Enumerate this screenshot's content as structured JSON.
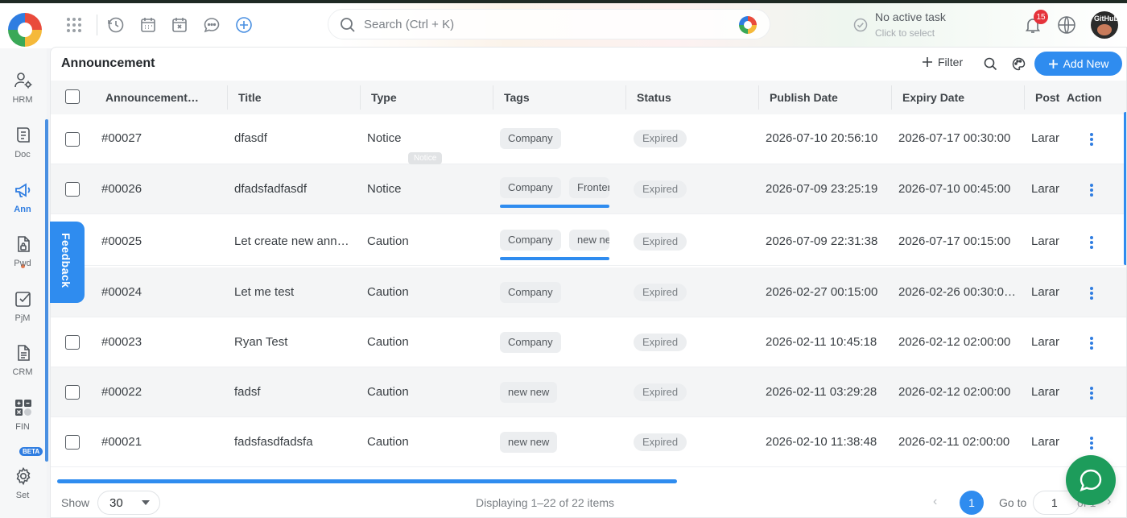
{
  "header": {
    "search_placeholder": "Search (Ctrl + K)",
    "task_title": "No active task",
    "task_subtitle": "Click to select",
    "notification_count": "15",
    "avatar_label": "GitHub"
  },
  "sidebar": {
    "items": [
      {
        "label": "HRM",
        "icon": "users-gear-icon"
      },
      {
        "label": "Doc",
        "icon": "document-icon"
      },
      {
        "label": "Ann",
        "icon": "megaphone-icon",
        "active": true
      },
      {
        "label": "Pwd",
        "icon": "password-file-icon"
      },
      {
        "label": "PjM",
        "icon": "checkbox-icon"
      },
      {
        "label": "CRM",
        "icon": "file-list-icon"
      },
      {
        "label": "FIN",
        "icon": "calculator-icon"
      },
      {
        "label": "Set",
        "icon": "settings-gear-icon"
      }
    ],
    "beta_label": "BETA"
  },
  "page": {
    "title": "Announcement",
    "filter_label": "Filter",
    "add_label": "Add New",
    "tooltip": "Notice",
    "feedback_label": "Feedback"
  },
  "table": {
    "columns": [
      "Announcement…",
      "Title",
      "Type",
      "Tags",
      "Status",
      "Publish Date",
      "Expiry Date",
      "Post",
      "Action"
    ],
    "rows": [
      {
        "id": "#00027",
        "title": "dfasdf",
        "type": "Notice",
        "tags": [
          "Company"
        ],
        "status": "Expired",
        "publish": "2026-07-10 20:56:10",
        "expiry": "2026-07-17 00:30:00",
        "poster": "Larar"
      },
      {
        "id": "#00026",
        "title": "dfadsfadfasdf",
        "type": "Notice",
        "tags": [
          "Company",
          "Frontenc"
        ],
        "status": "Expired",
        "publish": "2026-07-09 23:25:19",
        "expiry": "2026-07-10 00:45:00",
        "poster": "Larar"
      },
      {
        "id": "#00025",
        "title": "Let create new ann…",
        "type": "Caution",
        "tags": [
          "Company",
          "new new"
        ],
        "status": "Expired",
        "publish": "2026-07-09 22:31:38",
        "expiry": "2026-07-17 00:15:00",
        "poster": "Larar"
      },
      {
        "id": "#00024",
        "title": "Let me test",
        "type": "Caution",
        "tags": [
          "Company"
        ],
        "status": "Expired",
        "publish": "2026-02-27 00:15:00",
        "expiry": "2026-02-26 00:30:0…",
        "poster": "Larar"
      },
      {
        "id": "#00023",
        "title": "Ryan Test",
        "type": "Caution",
        "tags": [
          "Company"
        ],
        "status": "Expired",
        "publish": "2026-02-11 10:45:18",
        "expiry": "2026-02-12 02:00:00",
        "poster": "Larar"
      },
      {
        "id": "#00022",
        "title": "fadsf",
        "type": "Caution",
        "tags": [
          "new new"
        ],
        "status": "Expired",
        "publish": "2026-02-11 03:29:28",
        "expiry": "2026-02-12 02:00:00",
        "poster": "Larar"
      },
      {
        "id": "#00021",
        "title": "fadsfasdfadsfa",
        "type": "Caution",
        "tags": [
          "new new"
        ],
        "status": "Expired",
        "publish": "2026-02-10 11:38:48",
        "expiry": "2026-02-11 02:00:00",
        "poster": "Larar"
      }
    ]
  },
  "footer": {
    "show_label": "Show",
    "page_size": "30",
    "display_info": "Displaying 1–22 of 22 items",
    "current_page": "1",
    "goto_label": "Go to",
    "goto_value": "1",
    "of_label": "of 1"
  },
  "colors": {
    "accent": "#2f8cef",
    "chat": "#1d9c5b",
    "badge": "#e5333b"
  }
}
